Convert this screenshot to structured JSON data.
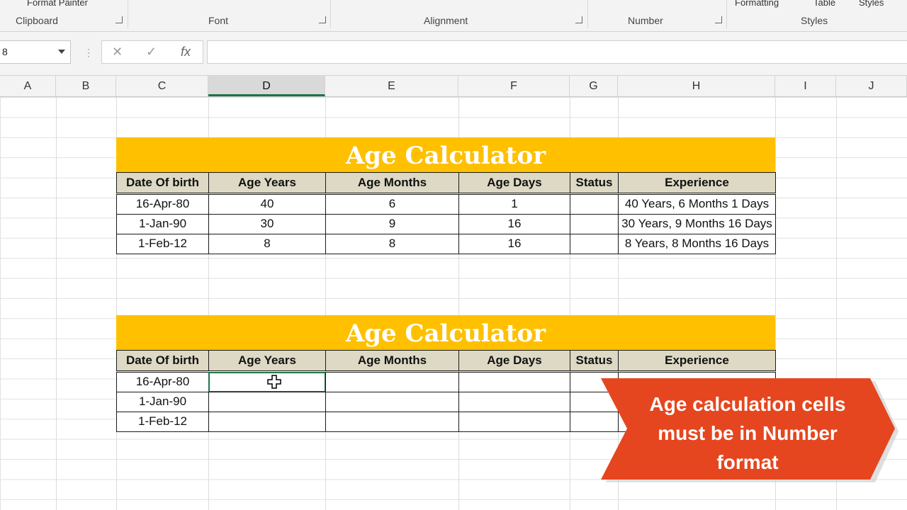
{
  "ribbon": {
    "format_painter": "Format Painter",
    "conditional_formatting": "Formatting",
    "format_as_table": "Table",
    "cell_styles": "Styles",
    "groups": {
      "clipboard": "Clipboard",
      "font": "Font",
      "alignment": "Alignment",
      "number": "Number",
      "styles": "Styles"
    }
  },
  "formula_bar": {
    "name_box": "8",
    "cancel_icon": "✕",
    "enter_icon": "✓",
    "function_icon": "fx",
    "value": ""
  },
  "columns": [
    "A",
    "B",
    "C",
    "D",
    "E",
    "F",
    "G",
    "H",
    "I",
    "J"
  ],
  "table1": {
    "title": "Age Calculator",
    "headers": [
      "Date Of birth",
      "Age Years",
      "Age Months",
      "Age Days",
      "Status",
      "Experience"
    ],
    "rows": [
      [
        "16-Apr-80",
        "40",
        "6",
        "1",
        "",
        "40 Years, 6 Months 1 Days"
      ],
      [
        "1-Jan-90",
        "30",
        "9",
        "16",
        "",
        "30 Years, 9 Months 16 Days"
      ],
      [
        "1-Feb-12",
        "8",
        "8",
        "16",
        "",
        "8 Years, 8 Months 16 Days"
      ]
    ]
  },
  "table2": {
    "title": "Age Calculator",
    "headers": [
      "Date Of birth",
      "Age Years",
      "Age Months",
      "Age Days",
      "Status",
      "Experience"
    ],
    "rows": [
      [
        "16-Apr-80",
        "",
        "",
        "",
        "",
        ""
      ],
      [
        "1-Jan-90",
        "",
        "",
        "",
        "",
        ""
      ],
      [
        "1-Feb-12",
        "",
        "",
        "",
        "",
        ""
      ]
    ]
  },
  "callout": {
    "line1": "Age calculation cells",
    "line2": "must be in Number",
    "line3": "format"
  },
  "colors": {
    "banner": "#ffc000",
    "header_fill": "#ddd9c4",
    "callout": "#e5461f",
    "selection": "#217346"
  }
}
